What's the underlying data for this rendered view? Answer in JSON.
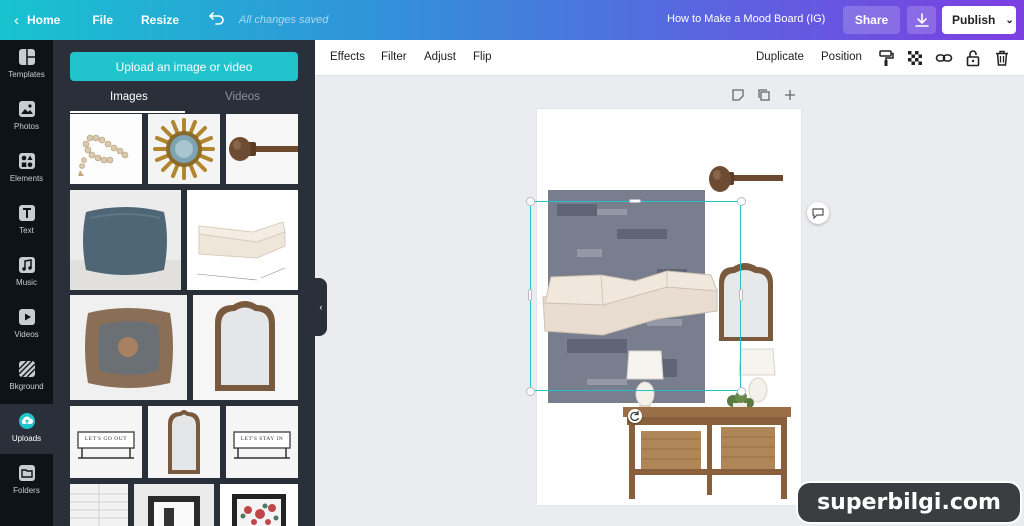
{
  "topbar": {
    "home_label": "Home",
    "file_label": "File",
    "resize_label": "Resize",
    "saved_status": "All changes saved",
    "design_title": "How to Make a Mood Board (IG)",
    "share_label": "Share",
    "publish_label": "Publish"
  },
  "leftnav": {
    "items": [
      {
        "label": "Templates",
        "icon": "templates-icon"
      },
      {
        "label": "Photos",
        "icon": "photos-icon"
      },
      {
        "label": "Elements",
        "icon": "elements-icon"
      },
      {
        "label": "Text",
        "icon": "text-icon"
      },
      {
        "label": "Music",
        "icon": "music-icon"
      },
      {
        "label": "Videos",
        "icon": "videos-icon"
      },
      {
        "label": "Bkground",
        "icon": "background-icon"
      },
      {
        "label": "Uploads",
        "icon": "uploads-icon"
      },
      {
        "label": "Folders",
        "icon": "folders-icon"
      }
    ],
    "active": "Uploads"
  },
  "panel": {
    "upload_label": "Upload an image or video",
    "tabs": [
      "Images",
      "Videos"
    ],
    "active_tab": "Images",
    "thumbnails": [
      "beads",
      "sunburst-mirror",
      "curtain-rod-finial",
      "blue-pillow",
      "sectional-sofa",
      "patterned-pillow",
      "arched-mirror",
      "lets-go-out-sign",
      "small-arched-mirror",
      "lets-stay-in-sign",
      "window-shutter",
      "framed-print",
      "floral-print"
    ],
    "sign_texts": [
      "LET'S GO OUT",
      "LET'S STAY IN"
    ]
  },
  "toolbar": {
    "effects": "Effects",
    "filter": "Filter",
    "adjust": "Adjust",
    "flip": "Flip",
    "duplicate": "Duplicate",
    "position": "Position"
  },
  "watermark": "superbilgi.com",
  "colors": {
    "accent": "#21c3cc",
    "panel_bg": "#293039",
    "nav_bg": "#0e1318"
  }
}
